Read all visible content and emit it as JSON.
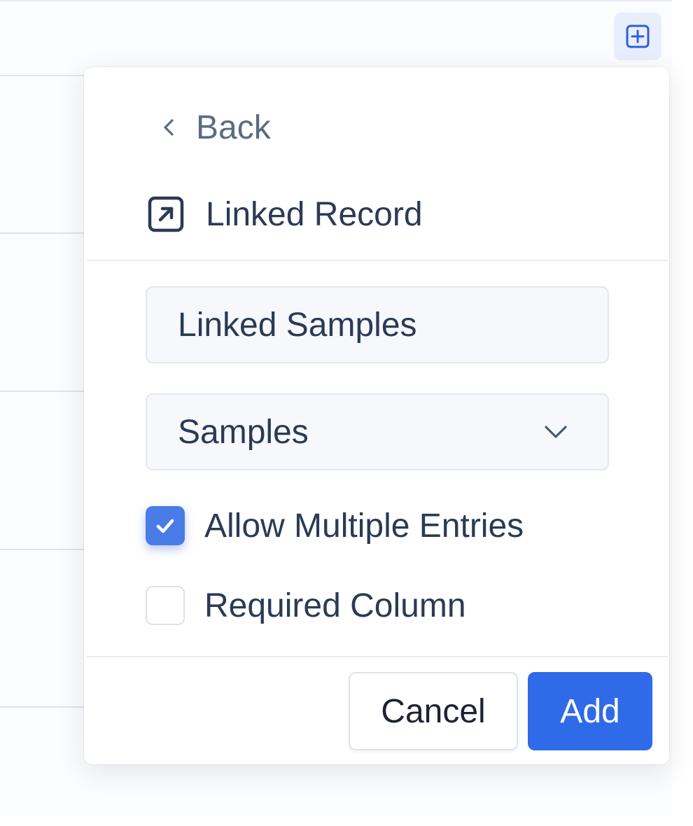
{
  "popover": {
    "back_label": "Back",
    "type_label": "Linked Record",
    "name_value": "Linked Samples",
    "table_select_value": "Samples",
    "allow_multiple_label": "Allow Multiple Entries",
    "allow_multiple_checked": true,
    "required_label": "Required Column",
    "required_checked": false,
    "cancel_label": "Cancel",
    "add_label": "Add"
  },
  "icons": {
    "add_column": "plus-square-icon",
    "back": "chevron-left-icon",
    "type": "arrow-up-right-square-icon",
    "select": "chevron-down-icon",
    "check": "check-icon"
  },
  "colors": {
    "primary": "#2f6be8",
    "checkbox_checked": "#4a7ce8",
    "text": "#2b3a55",
    "muted_text": "#5c6b83"
  }
}
